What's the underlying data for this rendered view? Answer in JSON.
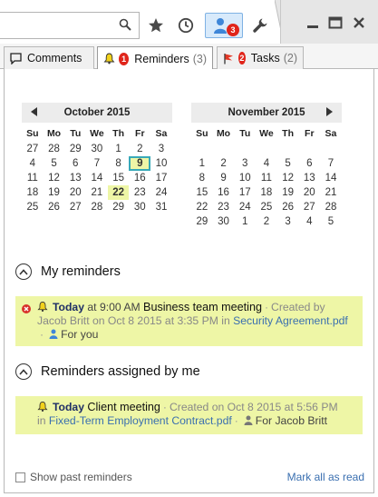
{
  "toolbar": {
    "search_icon": "search-icon",
    "notification_count": "3"
  },
  "tabs": [
    {
      "label": "Comments",
      "count": ""
    },
    {
      "label": "Reminders",
      "count": "(3)",
      "badge": "1"
    },
    {
      "label": "Tasks",
      "count": "(2)",
      "badge": "2"
    }
  ],
  "calendar": {
    "weekday_labels": [
      "Su",
      "Mo",
      "Tu",
      "We",
      "Th",
      "Fr",
      "Sa"
    ],
    "months": [
      {
        "title": "October 2015",
        "days": [
          [
            "27",
            "28",
            "29",
            "30",
            "1",
            "2",
            "3"
          ],
          [
            "4",
            "5",
            "6",
            "7",
            "8",
            "9",
            "10"
          ],
          [
            "11",
            "12",
            "13",
            "14",
            "15",
            "16",
            "17"
          ],
          [
            "18",
            "19",
            "20",
            "21",
            "22",
            "23",
            "24"
          ],
          [
            "25",
            "26",
            "27",
            "28",
            "29",
            "30",
            "31"
          ]
        ],
        "today": "9",
        "marked": [
          "22"
        ]
      },
      {
        "title": "November 2015",
        "days": [
          [
            "",
            "",
            "",
            "",
            "",
            "",
            ""
          ],
          [
            "1",
            "2",
            "3",
            "4",
            "5",
            "6",
            "7"
          ],
          [
            "8",
            "9",
            "10",
            "11",
            "12",
            "13",
            "14"
          ],
          [
            "15",
            "16",
            "17",
            "18",
            "19",
            "20",
            "21"
          ],
          [
            "22",
            "23",
            "24",
            "25",
            "26",
            "27",
            "28"
          ],
          [
            "29",
            "30",
            "1",
            "2",
            "3",
            "4",
            "5"
          ]
        ],
        "today": "",
        "marked": []
      }
    ]
  },
  "my_reminders": {
    "heading": "My reminders",
    "item": {
      "when": "Today",
      "time": "at 9:00 AM",
      "title": "Business team meeting",
      "created_by_label": "Created by",
      "creator": "Jacob Britt on Oct 8 2015 at 3:35 PM in",
      "document": "Security Agreement.pdf",
      "for_label": "For you"
    }
  },
  "assigned_reminders": {
    "heading": "Reminders assigned by me",
    "item": {
      "when": "Today",
      "title": "Client meeting",
      "created": "Created on Oct 8 2015 at 5:56 PM",
      "in_label": "in",
      "document": "Fixed-Term Employment Contract.pdf",
      "for_label": "For Jacob Britt"
    }
  },
  "footer": {
    "show_past": "Show past reminders",
    "mark_all": "Mark all as read"
  },
  "colors": {
    "highlight": "#eef6a6",
    "today_border": "#38a9b8",
    "badge_red": "#e0251b",
    "link_blue": "#3a6fb0"
  }
}
